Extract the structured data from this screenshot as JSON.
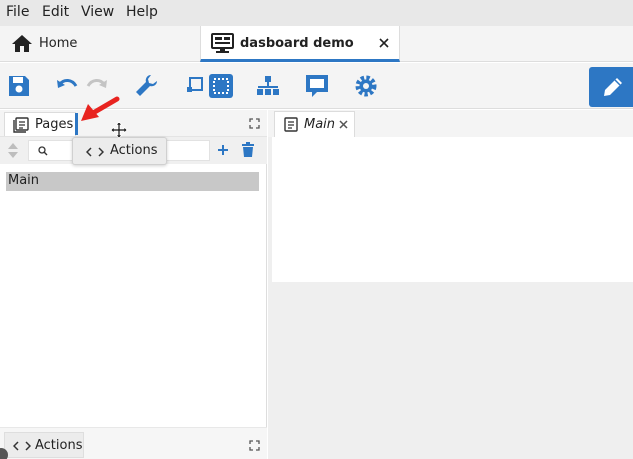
{
  "menu": [
    "File",
    "Edit",
    "View",
    "Help"
  ],
  "tabs": {
    "home_label": "Home",
    "dashboard_label": "dasboard demo"
  },
  "left_panel": {
    "pages_tab_label": "Pages",
    "search_value": "",
    "pages": [
      "Main"
    ],
    "actions_tab_label": "Actions"
  },
  "drag_ghost_label": "Actions",
  "editor": {
    "main_tab_label": "Main"
  },
  "colors": {
    "accent": "#2d77c4",
    "menubar_bg": "#e8e8e8",
    "selected_row": "#c8c8c8",
    "annotation_arrow": "#e8231f"
  },
  "icons": [
    "home-icon",
    "monitor-icon",
    "close-icon",
    "save-icon",
    "undo-icon",
    "redo-icon",
    "wrench-icon",
    "select-icon",
    "frame-icon",
    "hierarchy-icon",
    "message-icon",
    "gear-icon",
    "pencil-icon",
    "pages-icon",
    "search-icon",
    "plus-icon",
    "trash-icon",
    "code-icon",
    "expand-icon",
    "move-cursor-icon",
    "document-icon"
  ]
}
